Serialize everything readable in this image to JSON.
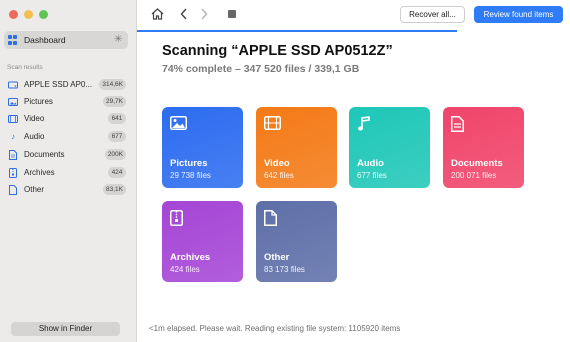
{
  "sidebar": {
    "dashboard_label": "Dashboard",
    "section_label": "Scan results",
    "items": [
      {
        "label": "APPLE SSD AP0...",
        "count": "314,6K",
        "icon": "drive-icon"
      },
      {
        "label": "Pictures",
        "count": "29,7K",
        "icon": "picture-icon"
      },
      {
        "label": "Video",
        "count": "641",
        "icon": "film-icon"
      },
      {
        "label": "Audio",
        "count": "677",
        "icon": "music-note-icon"
      },
      {
        "label": "Documents",
        "count": "200K",
        "icon": "document-icon"
      },
      {
        "label": "Archives",
        "count": "424",
        "icon": "archive-icon"
      },
      {
        "label": "Other",
        "count": "83,1K",
        "icon": "file-icon"
      }
    ],
    "finder_button": "Show in Finder"
  },
  "toolbar": {
    "recover_label": "Recover all...",
    "review_label": "Review found items"
  },
  "main": {
    "title": "Scanning “APPLE SSD AP0512Z”",
    "subtitle": "74% complete – 347 520 files / 339,1 GB",
    "progress": 0.74,
    "cards": [
      {
        "name": "Pictures",
        "count": "29 738 files",
        "color": "#2c6cf0"
      },
      {
        "name": "Video",
        "count": "642 files",
        "color": "#f47a16"
      },
      {
        "name": "Audio",
        "count": "677 files",
        "color": "#1ec7b8"
      },
      {
        "name": "Documents",
        "count": "200 071 files",
        "color": "#f0446a"
      },
      {
        "name": "Archives",
        "count": "424 files",
        "color": "#a545d6"
      },
      {
        "name": "Other",
        "count": "83 173 files",
        "color": "#5e6fa8"
      }
    ],
    "status": "<1m elapsed. Please wait. Reading existing file system: 1105920 items"
  }
}
